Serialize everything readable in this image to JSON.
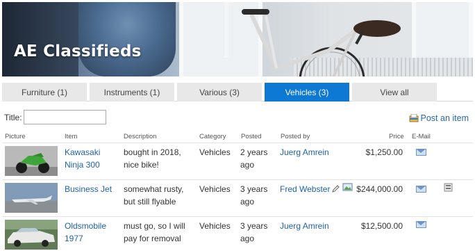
{
  "app": {
    "title": "AE Classifieds"
  },
  "tabs": [
    {
      "label": "Furniture (1)",
      "active": false
    },
    {
      "label": "Instruments (1)",
      "active": false
    },
    {
      "label": "Various (3)",
      "active": false
    },
    {
      "label": "Vehicles (3)",
      "active": true
    },
    {
      "label": "View all",
      "active": false
    }
  ],
  "filter": {
    "label": "Title:",
    "value": "",
    "placeholder": ""
  },
  "post_item": {
    "label": "Post an item",
    "icon": "post-item-icon"
  },
  "columns": [
    "Picture",
    "Item",
    "Description",
    "Category",
    "Posted",
    "Posted by",
    "Price",
    "E-Mail"
  ],
  "rows": [
    {
      "picture": "motorcycle-photo",
      "item_line1": "Kawasaki",
      "item_line2": "Ninja 300",
      "desc_line1": "bought in 2018,",
      "desc_line2": "nice bike!",
      "category": "Vehicles",
      "posted_line1": "2 years",
      "posted_line2": "ago",
      "posted_by": "Juerg Amrein",
      "price": "$1,250.00",
      "email_icon": "mail-icon"
    },
    {
      "picture": "jet-photo",
      "item_line1": "Business Jet",
      "item_line2": "",
      "desc_line1": "somewhat rusty,",
      "desc_line2": "but still flyable",
      "category": "Vehicles",
      "posted_line1": "3 years",
      "posted_line2": "ago",
      "posted_by": "Fred Webster",
      "price": "$244,000.00",
      "email_icon": "mail-icon",
      "extra_icons": [
        "edit-icon",
        "image-edit-icon",
        "details-icon"
      ]
    },
    {
      "picture": "car-photo",
      "item_line1": "Oldsmobile",
      "item_line2": "1977",
      "desc_line1": "must go, so I will",
      "desc_line2": "pay for removal",
      "category": "Vehicles",
      "posted_line1": "3 years",
      "posted_line2": "ago",
      "posted_by": "Juerg Amrein",
      "price": "$12,500.00",
      "email_icon": "mail-icon"
    }
  ],
  "colors": {
    "accent": "#0e78d5",
    "link": "#1f62a8",
    "tab_bg": "#e8e8e8"
  }
}
